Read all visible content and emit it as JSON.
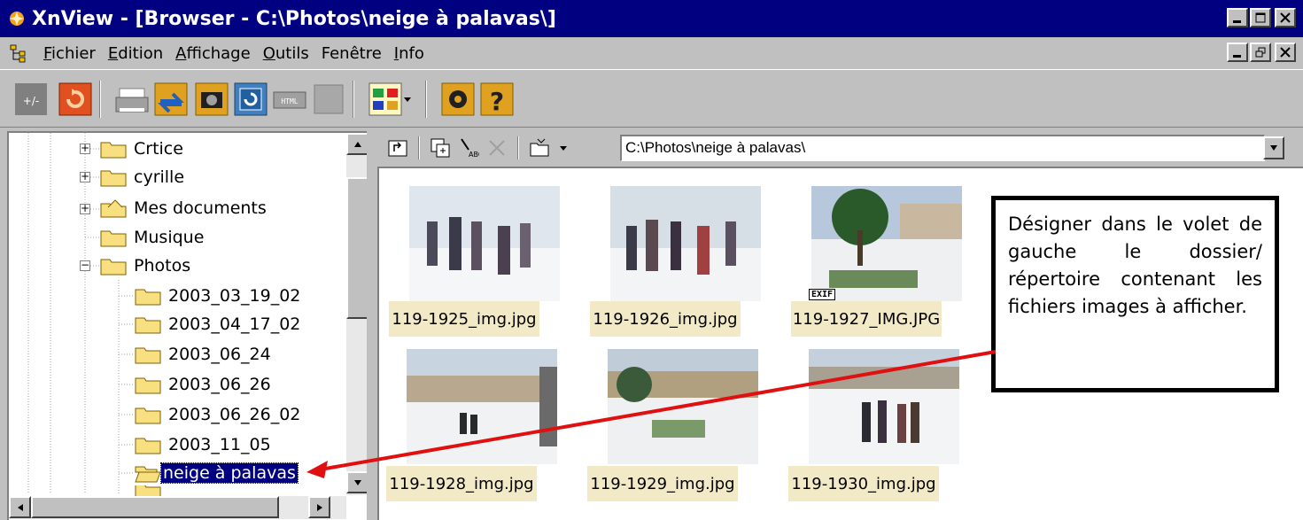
{
  "window": {
    "title": "XnView - [Browser - C:\\Photos\\neige à palavas\\]"
  },
  "menu": {
    "items": [
      {
        "key": "F",
        "rest": "ichier"
      },
      {
        "key": "E",
        "rest": "dition"
      },
      {
        "key": "A",
        "rest": "ffichage"
      },
      {
        "key": "O",
        "rest": "utils"
      },
      {
        "key": "",
        "rest": "Fenêtre"
      },
      {
        "key": "I",
        "rest": "nfo"
      }
    ]
  },
  "tree": {
    "items": [
      {
        "label": "Crtice"
      },
      {
        "label": "cyrille"
      },
      {
        "label": "Mes documents"
      },
      {
        "label": "Musique"
      },
      {
        "label": "Photos"
      },
      {
        "label": "2003_03_19_02"
      },
      {
        "label": "2003_04_17_02"
      },
      {
        "label": "2003_06_24"
      },
      {
        "label": "2003_06_26"
      },
      {
        "label": "2003_06_26_02"
      },
      {
        "label": "2003_11_05"
      },
      {
        "label": "neige à palavas"
      }
    ]
  },
  "address": {
    "path": "C:\\Photos\\neige à palavas\\"
  },
  "thumbnails": [
    {
      "name": "119-1925_img.jpg"
    },
    {
      "name": "119-1926_img.jpg"
    },
    {
      "name": "119-1927_IMG.JPG",
      "badge": "EXIF"
    },
    {
      "name": "119-1928_img.jpg"
    },
    {
      "name": "119-1929_img.jpg"
    },
    {
      "name": "119-1930_img.jpg"
    }
  ],
  "callout": {
    "text": "Désigner dans le volet de gauche le dossier/ répertoire contenant les fichiers images à afficher."
  },
  "colors": {
    "titlebar": "#000080",
    "selection": "#000080",
    "caption_bg": "#f2e9c6",
    "arrow": "#e01010"
  }
}
